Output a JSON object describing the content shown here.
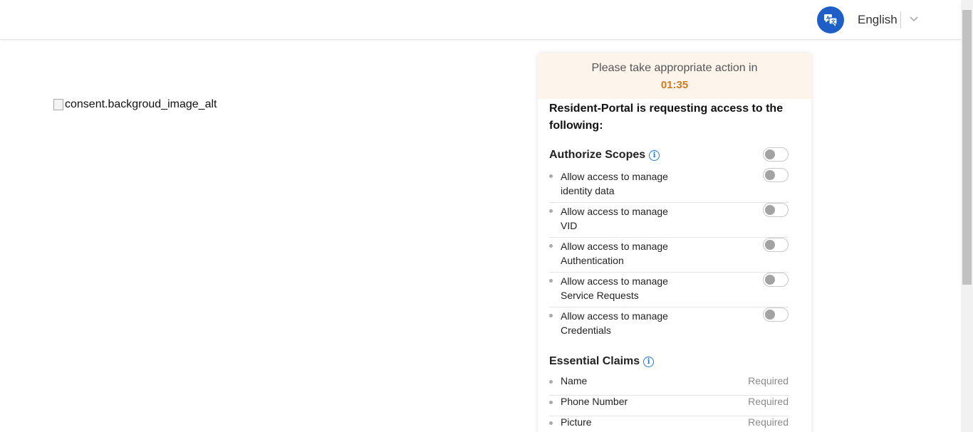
{
  "header": {
    "language_icon": "translate-icon",
    "language": "English",
    "dropdown_icon": "chevron-down-icon"
  },
  "background": {
    "image_alt": "consent.backgroud_image_alt"
  },
  "consent": {
    "timer_text": "Please take appropriate action in",
    "timer_value": "01:35",
    "request_title": "Resident-Portal is requesting access to the following:",
    "authorize_scopes": {
      "title": "Authorize Scopes",
      "items": [
        {
          "line1": "Allow access to manage",
          "line2": "identity data"
        },
        {
          "line1": "Allow access to manage",
          "line2": "VID"
        },
        {
          "line1": "Allow access to manage",
          "line2": "Authentication"
        },
        {
          "line1": "Allow access to manage",
          "line2": "Service Requests"
        },
        {
          "line1": "Allow access to manage",
          "line2": "Credentials"
        }
      ]
    },
    "essential_claims": {
      "title": "Essential Claims",
      "items": [
        {
          "label": "Name",
          "status": "Required"
        },
        {
          "label": "Phone Number",
          "status": "Required"
        },
        {
          "label": "Picture",
          "status": "Required"
        }
      ]
    }
  },
  "colors": {
    "brand_blue": "#1d5fc7",
    "timer_bg": "#fdf5ec",
    "timer_accent": "#d07a1e",
    "info_blue": "#1d7ad6"
  }
}
